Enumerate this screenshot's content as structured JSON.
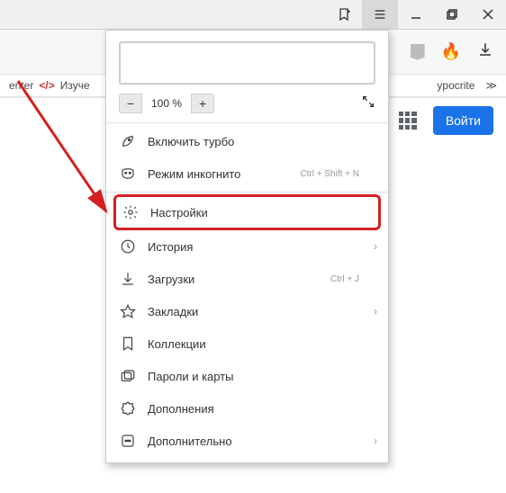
{
  "window": {
    "bookmark_aria": "bookmark-page",
    "menu_aria": "main-menu"
  },
  "toolbar": {
    "fire_icon": "🔥"
  },
  "tabstrip": {
    "left_fragment": "enter",
    "left_tab": "Изуче",
    "right_fragment": "ypocrite",
    "more_glyph": "≫"
  },
  "header": {
    "login_label": "Войти"
  },
  "menu": {
    "zoom": {
      "minus": "−",
      "value": "100 %",
      "plus": "+"
    },
    "items": [
      {
        "label": "Включить турбо",
        "shortcut": "",
        "chevron": false,
        "icon": "rocket",
        "highlight": false
      },
      {
        "label": "Режим инкогнито",
        "shortcut": "Ctrl + Shift + N",
        "chevron": false,
        "icon": "mask",
        "highlight": false
      },
      {
        "label": "Настройки",
        "shortcut": "",
        "chevron": false,
        "icon": "gear",
        "highlight": true
      },
      {
        "label": "История",
        "shortcut": "",
        "chevron": true,
        "icon": "history",
        "highlight": false
      },
      {
        "label": "Загрузки",
        "shortcut": "Ctrl + J",
        "chevron": false,
        "icon": "download",
        "highlight": false
      },
      {
        "label": "Закладки",
        "shortcut": "",
        "chevron": true,
        "icon": "star",
        "highlight": false
      },
      {
        "label": "Коллекции",
        "shortcut": "",
        "chevron": false,
        "icon": "flag",
        "highlight": false
      },
      {
        "label": "Пароли и карты",
        "shortcut": "",
        "chevron": false,
        "icon": "cards",
        "highlight": false
      },
      {
        "label": "Дополнения",
        "shortcut": "",
        "chevron": false,
        "icon": "puzzle",
        "highlight": false
      },
      {
        "label": "Дополнительно",
        "shortcut": "",
        "chevron": true,
        "icon": "more",
        "highlight": false
      }
    ]
  }
}
